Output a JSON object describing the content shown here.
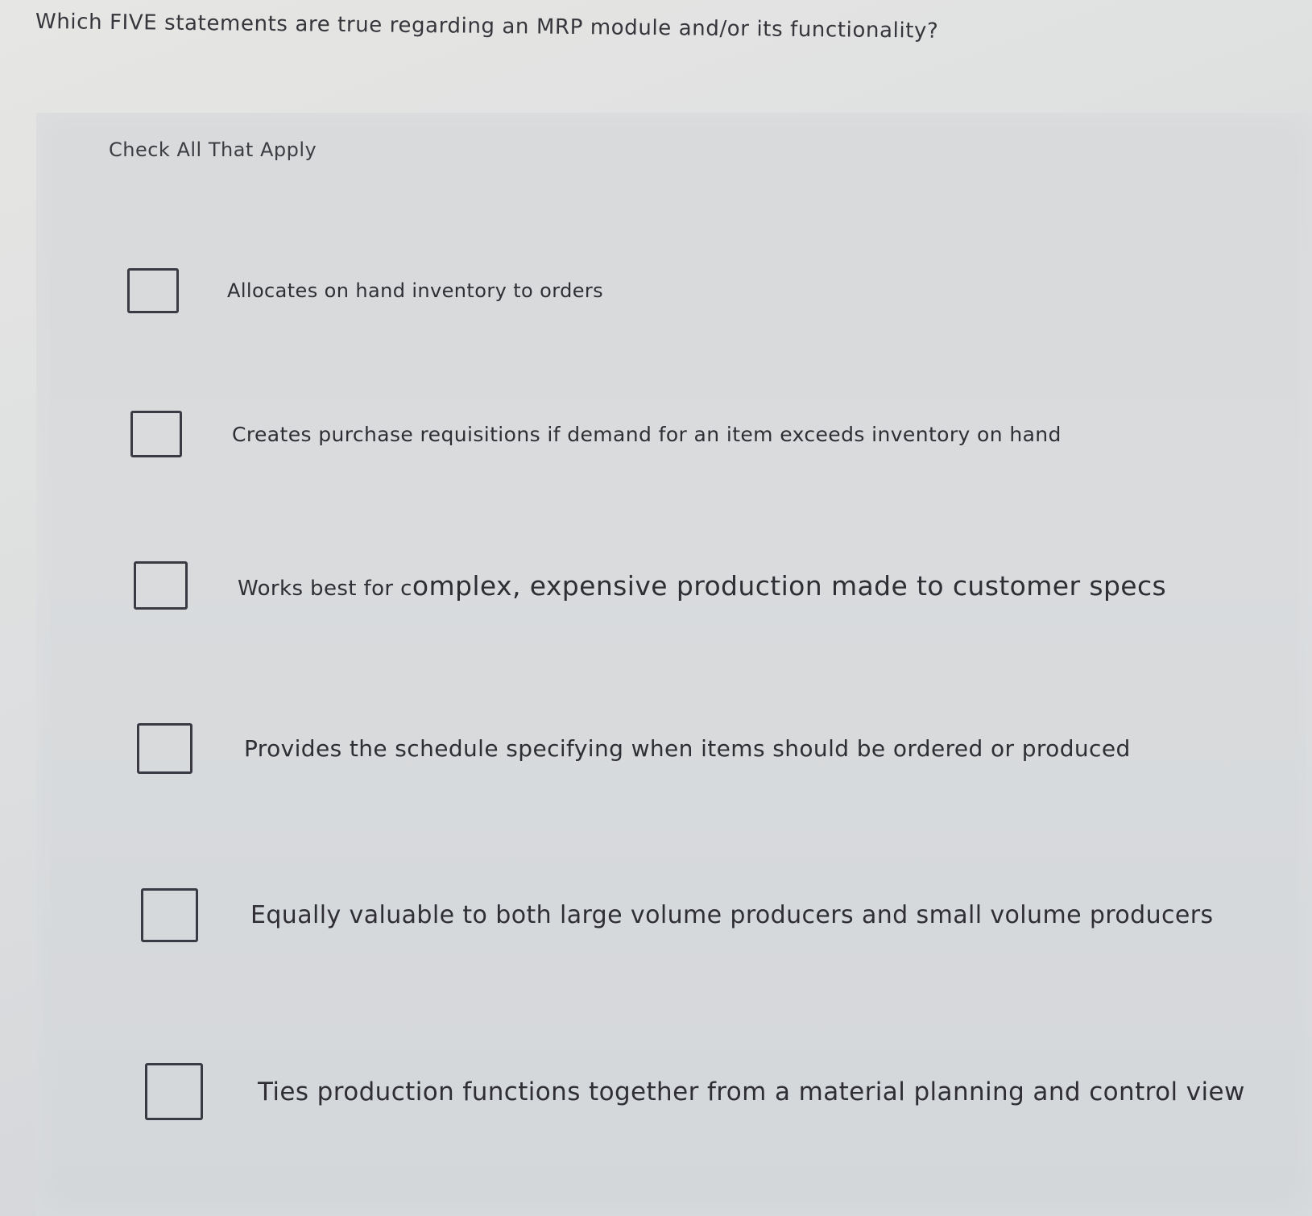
{
  "question": {
    "text": "Which FIVE statements are true regarding an MRP module and/or its functionality?"
  },
  "instruction": "Check All That Apply",
  "options": [
    {
      "label": "Allocates on hand inventory to orders",
      "checked": false
    },
    {
      "label": "Creates purchase requisitions if demand for an item exceeds inventory on hand",
      "checked": false
    },
    {
      "label_part1": "Works best for c",
      "label_part2": "omplex, expensive production made to customer specs",
      "checked": false
    },
    {
      "label": "Provides the schedule specifying when items should be ordered or produced",
      "checked": false
    },
    {
      "label": "Equally valuable to both large volume producers and small volume producers",
      "checked": false
    },
    {
      "label": "Ties production functions together from a material planning and control view",
      "checked": false
    }
  ],
  "colors": {
    "text": "#2f2f33",
    "checkbox_border": "#3a3a44",
    "background": "#dcdedf"
  }
}
